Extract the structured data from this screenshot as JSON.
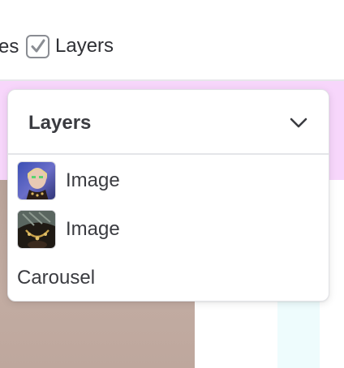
{
  "toolbar": {
    "clipped_label": "es",
    "layers_toggle": {
      "label": "Layers",
      "checked": true
    }
  },
  "layers_panel": {
    "title": "Layers",
    "collapse_icon": "chevron-down-icon",
    "items": [
      {
        "label": "Image",
        "thumbnail": "portrait-image-thumbnail"
      },
      {
        "label": "Image",
        "thumbnail": "jewelry-image-thumbnail"
      },
      {
        "label": "Carousel",
        "thumbnail": null
      }
    ]
  },
  "colors": {
    "text": "#2f3035",
    "panel_background": "#ffffff",
    "panel_border": "#e1e2e6",
    "canvas_pink": "#f7d6fb",
    "canvas_image_tone": "#c2aca2",
    "canvas_light_cyan": "#eefcfd",
    "checkbox_border": "#8a8d93"
  }
}
